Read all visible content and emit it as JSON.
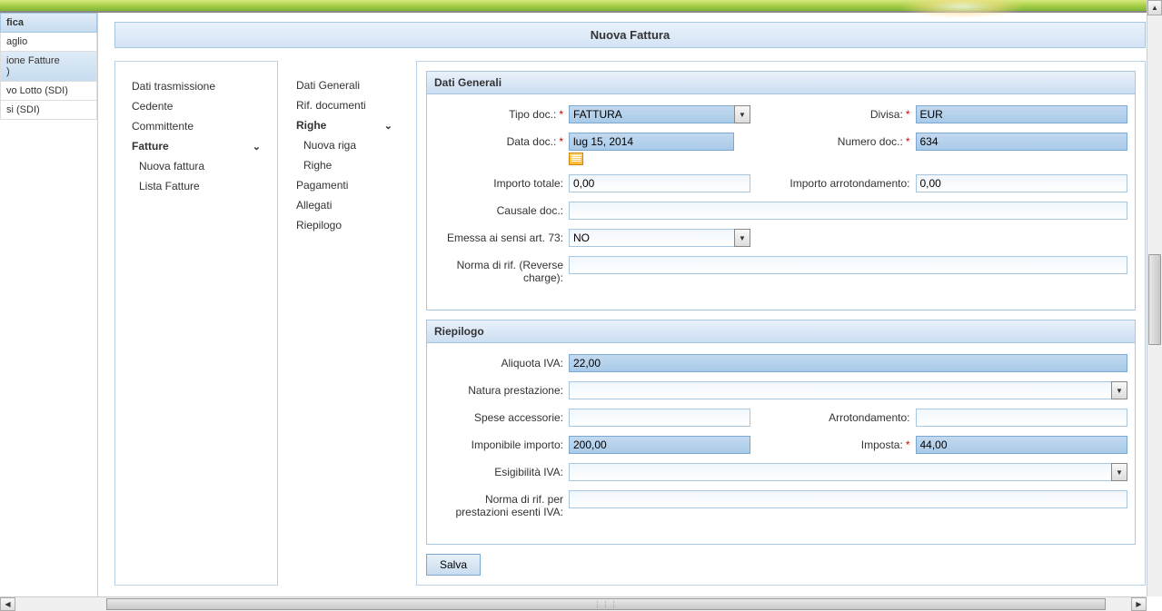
{
  "leftSidebar": {
    "header1": "fica",
    "item1": "aglio",
    "item2": "ione Fatture",
    "item2b": ")",
    "item3": "vo Lotto (SDI)",
    "item4": "si (SDI)"
  },
  "pageTitle": "Nuova Fattura",
  "nav1": {
    "item1": "Dati trasmissione",
    "item2": "Cedente",
    "item3": "Committente",
    "item4": "Fatture",
    "sub1": "Nuova fattura",
    "sub2": "Lista Fatture"
  },
  "nav2": {
    "item1": "Dati Generali",
    "item2": "Rif. documenti",
    "item3": "Righe",
    "sub1": "Nuova riga",
    "sub2": "Righe",
    "item4": "Pagamenti",
    "item5": "Allegati",
    "item6": "Riepilogo"
  },
  "panels": {
    "datiGenerali": {
      "title": "Dati Generali",
      "tipoDoc": {
        "label": "Tipo doc.:",
        "value": "FATTURA"
      },
      "divisa": {
        "label": "Divisa:",
        "value": "EUR"
      },
      "dataDoc": {
        "label": "Data doc.:",
        "value": "lug 15, 2014"
      },
      "numeroDoc": {
        "label": "Numero doc.:",
        "value": "634"
      },
      "importoTotale": {
        "label": "Importo totale:",
        "value": "0,00"
      },
      "importoArr": {
        "label": "Importo arrotondamento:",
        "value": "0,00"
      },
      "causale": {
        "label": "Causale doc.:",
        "value": ""
      },
      "emessa": {
        "label": "Emessa ai sensi art. 73:",
        "value": "NO"
      },
      "norma": {
        "label": "Norma di rif. (Reverse charge):",
        "value": ""
      }
    },
    "riepilogo": {
      "title": "Riepilogo",
      "aliquota": {
        "label": "Aliquota IVA:",
        "value": "22,00"
      },
      "natura": {
        "label": "Natura prestazione:",
        "value": ""
      },
      "spese": {
        "label": "Spese accessorie:",
        "value": ""
      },
      "arrot": {
        "label": "Arrotondamento:",
        "value": ""
      },
      "imponibile": {
        "label": "Imponibile importo:",
        "value": "200,00"
      },
      "imposta": {
        "label": "Imposta:",
        "value": "44,00"
      },
      "esigibilita": {
        "label": "Esigibilità IVA:",
        "value": ""
      },
      "normaRif": {
        "label": "Norma di rif. per prestazioni esenti IVA:",
        "value": ""
      }
    }
  },
  "buttons": {
    "salva": "Salva"
  }
}
